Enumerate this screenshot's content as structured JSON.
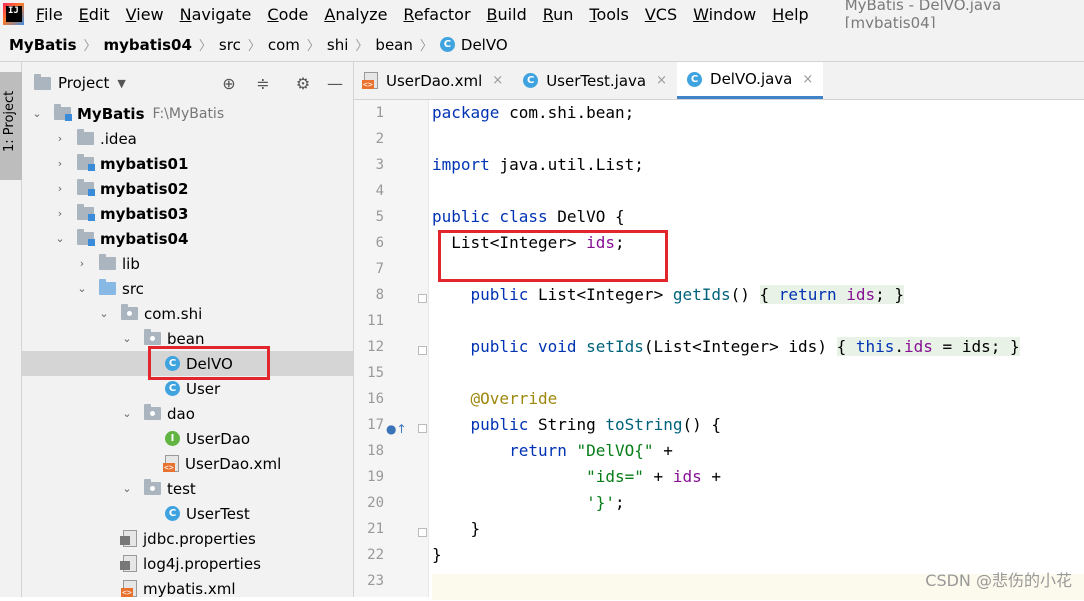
{
  "menubar": {
    "logo_label": "IJ",
    "items": [
      "File",
      "Edit",
      "View",
      "Navigate",
      "Code",
      "Analyze",
      "Refactor",
      "Build",
      "Run",
      "Tools",
      "VCS",
      "Window",
      "Help"
    ],
    "window_title": "MyBatis - DelVO.java [mybatis04]"
  },
  "breadcrumb": [
    "MyBatis",
    "mybatis04",
    "src",
    "com",
    "shi",
    "bean",
    "DelVO"
  ],
  "sidebar_strip": {
    "label": "1: Project"
  },
  "project_panel": {
    "title": "Project",
    "tree": [
      {
        "label": "MyBatis",
        "path": "F:\\MyBatis",
        "bold": true
      },
      {
        "label": ".idea"
      },
      {
        "label": "mybatis01",
        "bold": true
      },
      {
        "label": "mybatis02",
        "bold": true
      },
      {
        "label": "mybatis03",
        "bold": true
      },
      {
        "label": "mybatis04",
        "bold": true
      },
      {
        "label": "lib"
      },
      {
        "label": "src"
      },
      {
        "label": "com.shi"
      },
      {
        "label": "bean"
      },
      {
        "label": "DelVO"
      },
      {
        "label": "User"
      },
      {
        "label": "dao"
      },
      {
        "label": "UserDao"
      },
      {
        "label": "UserDao.xml"
      },
      {
        "label": "test"
      },
      {
        "label": "UserTest"
      },
      {
        "label": "jdbc.properties"
      },
      {
        "label": "log4j.properties"
      },
      {
        "label": "mybatis.xml"
      }
    ]
  },
  "tabs": [
    {
      "label": "UserDao.xml",
      "icon": "xml-file-icon"
    },
    {
      "label": "UserTest.java",
      "icon": "test-class-icon"
    },
    {
      "label": "DelVO.java",
      "icon": "class-icon",
      "active": true
    }
  ],
  "tab_close": "×",
  "line_numbers": [
    "1",
    "2",
    "3",
    "4",
    "5",
    "6",
    "7",
    "8",
    "11",
    "12",
    "15",
    "16",
    "17",
    "18",
    "19",
    "20",
    "21",
    "22",
    "23"
  ],
  "code": {
    "l1": "com.shi.bean;",
    "l3": "java.util.List;",
    "l5_name": "DelVO {",
    "l6_type": "List<Integer> ",
    "l6_field": "ids",
    "l8_type": "List<Integer> ",
    "l8_method": "getIds",
    "l12_method": "setIds",
    "l12_params": "(List<Integer> ids) ",
    "l16": "@Override",
    "l17_type": "String ",
    "l17_method": "toString",
    "l18_str": "\"DelVO{\"",
    "l19_str": "\"ids=\"",
    "l20_str": "'}'"
  },
  "watermark": "CSDN @悲伤的小花"
}
